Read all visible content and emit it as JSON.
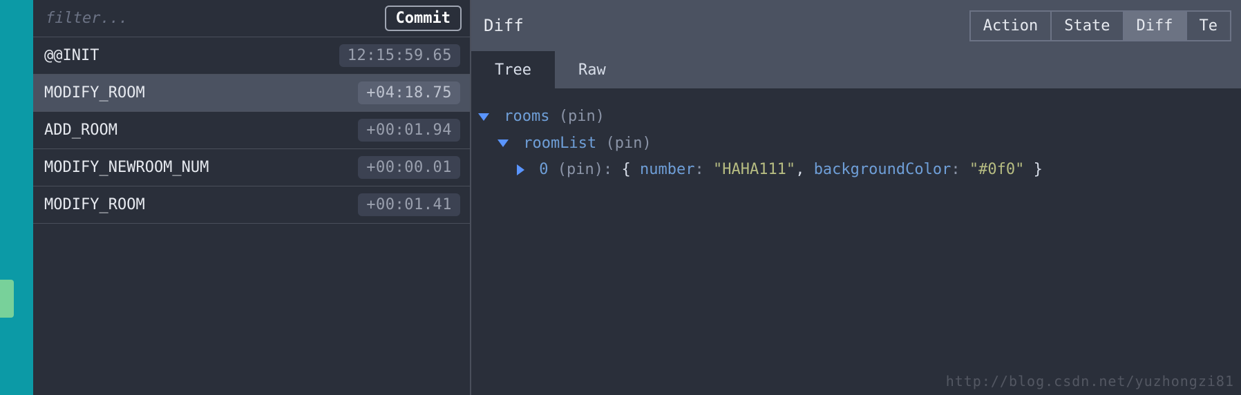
{
  "filter": {
    "placeholder": "filter..."
  },
  "commit_label": "Commit",
  "actions": [
    {
      "name": "@@INIT",
      "time": "12:15:59.65",
      "selected": false
    },
    {
      "name": "MODIFY_ROOM",
      "time": "+04:18.75",
      "selected": true
    },
    {
      "name": "ADD_ROOM",
      "time": "+00:01.94",
      "selected": false
    },
    {
      "name": "MODIFY_NEWROOM_NUM",
      "time": "+00:00.01",
      "selected": false
    },
    {
      "name": "MODIFY_ROOM",
      "time": "+00:01.41",
      "selected": false
    }
  ],
  "right": {
    "title": "Diff",
    "view_tabs": [
      {
        "label": "Action",
        "active": false
      },
      {
        "label": "State",
        "active": false
      },
      {
        "label": "Diff",
        "active": true
      },
      {
        "label": "Te",
        "active": false
      }
    ],
    "sub_tabs": [
      {
        "label": "Tree",
        "active": true
      },
      {
        "label": "Raw",
        "active": false
      }
    ]
  },
  "tree": {
    "root_key": "rooms",
    "root_pin": "(pin)",
    "child_key": "roomList",
    "child_pin": "(pin)",
    "leaf_index": "0",
    "leaf_pin": "(pin)",
    "leaf_colon": ":",
    "brace_open": "{",
    "prop1_key": "number",
    "prop1_colon": ":",
    "prop1_val": "\"HAHA111\"",
    "comma": ",",
    "prop2_key": "backgroundColor",
    "prop2_colon": ":",
    "prop2_val": "\"#0f0\"",
    "brace_close": "}"
  },
  "watermark": "http://blog.csdn.net/yuzhongzi81"
}
